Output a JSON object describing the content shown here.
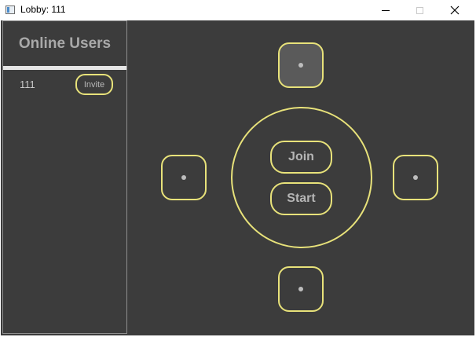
{
  "window": {
    "title": "Lobby: 111",
    "icons": {
      "app": "app-window-icon",
      "minimize": "minimize-icon",
      "maximize": "maximize-icon",
      "close": "close-icon"
    },
    "close_glyph": "✕"
  },
  "sidebar": {
    "title": "Online Users",
    "users": [
      {
        "name": "111",
        "action_label": "Invite"
      }
    ]
  },
  "lobby": {
    "seats": [
      {
        "position": "top",
        "occupied": true
      },
      {
        "position": "left",
        "occupied": false
      },
      {
        "position": "right",
        "occupied": false
      },
      {
        "position": "bottom",
        "occupied": false
      }
    ],
    "join_label": "Join",
    "start_label": "Start"
  },
  "colors": {
    "background": "#3c3c3c",
    "accent_border": "#e8e27a",
    "text_muted": "#a9a9a9"
  }
}
